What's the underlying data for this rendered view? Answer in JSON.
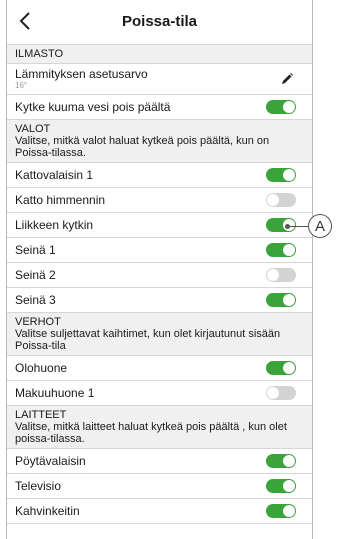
{
  "header": {
    "title": "Poissa-tila",
    "back_icon": "chevron-left-icon"
  },
  "sections": {
    "climate": {
      "name": "ILMASTO",
      "setpoint_label": "Lämmityksen asetusarvo",
      "setpoint_value": "16°",
      "hot_water_label": "Kytke kuuma vesi pois päältä",
      "hot_water_on": true
    },
    "lights": {
      "name": "VALOT",
      "desc": "Valitse, mitkä valot haluat kytkeä pois päältä, kun on Poissa-tilassa.",
      "items": [
        {
          "label": "Kattovalaisin 1",
          "on": true
        },
        {
          "label": "Katto himmennin",
          "on": false
        },
        {
          "label": "Liikkeen kytkin",
          "on": true
        },
        {
          "label": "Seinä 1",
          "on": true
        },
        {
          "label": "Seinä 2",
          "on": false
        },
        {
          "label": "Seinä 3",
          "on": true
        }
      ]
    },
    "curtains": {
      "name": "VERHOT",
      "desc": "Valitse suljettavat kaihtimet, kun olet kirjautunut sisään Poissa-tila",
      "items": [
        {
          "label": "Olohuone",
          "on": true
        },
        {
          "label": "Makuuhuone 1",
          "on": false
        }
      ]
    },
    "devices": {
      "name": "LAITTEET",
      "desc": "Valitse, mitkä laitteet haluat kytkeä pois päältä , kun olet poissa-tilassa.",
      "items": [
        {
          "label": "Pöytävalaisin",
          "on": true
        },
        {
          "label": "Televisio",
          "on": true
        },
        {
          "label": "Kahvinkeitin",
          "on": true
        }
      ]
    }
  },
  "callout": {
    "label": "A"
  },
  "colors": {
    "toggle_on": "#3aa43a",
    "toggle_off": "#d3d3d3",
    "section_bg": "#f0f0f0"
  }
}
